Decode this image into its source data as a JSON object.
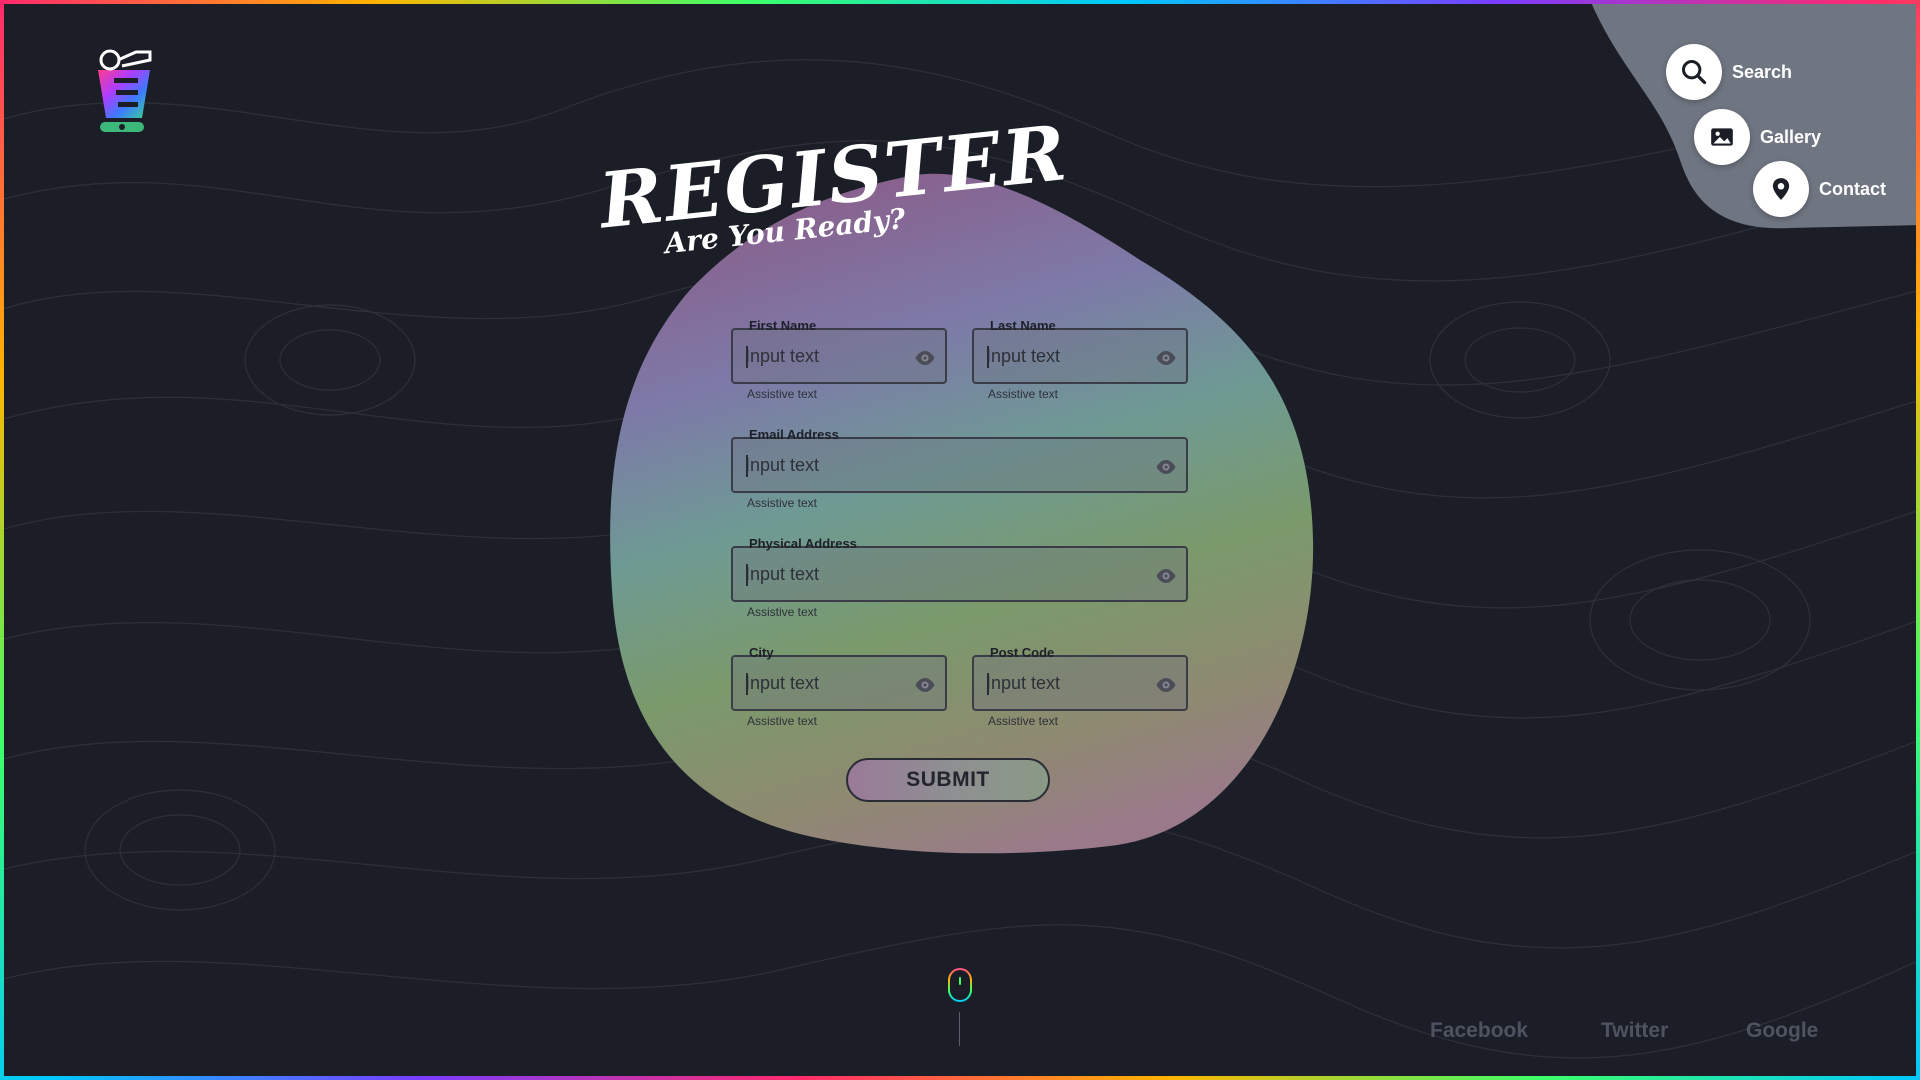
{
  "nav": {
    "items": [
      {
        "label": "Search",
        "icon": "search-icon"
      },
      {
        "label": "Gallery",
        "icon": "image-icon"
      },
      {
        "label": "Contact",
        "icon": "map-pin-icon"
      }
    ]
  },
  "header": {
    "title": "Register",
    "subtitle": "Are You Ready?"
  },
  "form": {
    "fields": [
      {
        "label": "First Name",
        "placeholder": "Input text",
        "assistive": "Assistive text"
      },
      {
        "label": "Last Name",
        "placeholder": "Input text",
        "assistive": "Assistive text"
      },
      {
        "label": "Email Address",
        "placeholder": "Input text",
        "assistive": "Assistive text"
      },
      {
        "label": "Physical Address",
        "placeholder": "Input text",
        "assistive": "Assistive text"
      },
      {
        "label": "City",
        "placeholder": "Input text",
        "assistive": "Assistive text"
      },
      {
        "label": "Post Code",
        "placeholder": "Input text",
        "assistive": "Assistive text"
      }
    ],
    "submit_label": "SUBMIT"
  },
  "social": {
    "links": [
      "Facebook",
      "Twitter",
      "Google"
    ]
  },
  "colors": {
    "background": "#1b1e27",
    "nav_blob": "#6f7581",
    "social_text": "#4f5361"
  }
}
